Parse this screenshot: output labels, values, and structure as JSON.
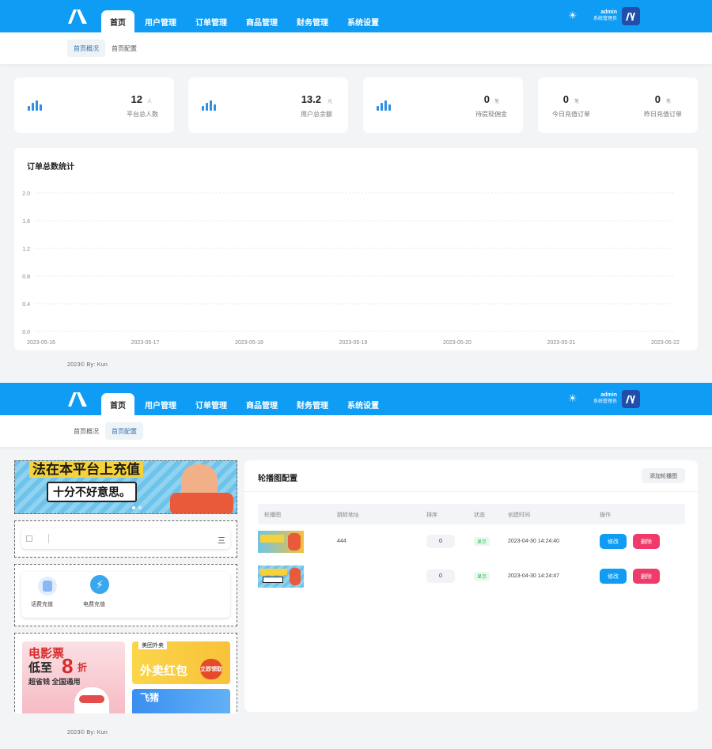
{
  "header": {
    "nav": [
      "首页",
      "用户管理",
      "订单管理",
      "商品管理",
      "财务管理",
      "系统设置"
    ],
    "user_name": "admin",
    "user_role": "系统管理员",
    "avatar_text": "ꟿ"
  },
  "subtabs": [
    "首页概况",
    "首页配置"
  ],
  "stats": [
    {
      "value": "12",
      "unit": "人",
      "label": "平台总人数"
    },
    {
      "value": "13.2",
      "unit": "元",
      "label": "用户总余额"
    },
    {
      "value": "0",
      "unit": "笔",
      "label": "待提现佣金"
    },
    {
      "value": "0",
      "unit": "笔",
      "label": "今日充值订单"
    },
    {
      "value": "0",
      "unit": "笔",
      "label": "昨日充值订单"
    }
  ],
  "chart_title": "订单总数统计",
  "chart_data": {
    "type": "line",
    "title": "订单总数统计",
    "x": [
      "2023-05-16",
      "2023-05-17",
      "2023-05-18",
      "2023-05-19",
      "2023-05-20",
      "2023-05-21",
      "2023-05-22"
    ],
    "yticks": [
      "0.0",
      "0.4",
      "0.8",
      "1.2",
      "1.6",
      "2.0"
    ],
    "ylim": [
      0,
      2.0
    ],
    "series": [
      {
        "values": [
          0,
          0,
          0,
          0,
          0,
          0,
          0
        ]
      }
    ],
    "grid": true
  },
  "footer": "2023© By: Kun",
  "banner_panel": {
    "title": "轮播图配置",
    "add_button": "添加轮播图",
    "columns": [
      "轮播图",
      "跳转地址",
      "排序",
      "状态",
      "创建时间",
      "操作"
    ],
    "rows": [
      {
        "url": "444",
        "sort": "0",
        "status": "显示",
        "created": "2023-04-30 14:24:40",
        "edit": "修改",
        "delete": "删除"
      },
      {
        "url": "",
        "sort": "0",
        "status": "显示",
        "created": "2023-04-30 14:24:47",
        "edit": "修改",
        "delete": "删除"
      }
    ]
  },
  "preview": {
    "banner_text_1": "法在本平台上充值",
    "banner_text_2": "十分不好意思。",
    "search_right": "三",
    "service_1": "话费充值",
    "service_2": "电费充值",
    "promo_movie_1": "电影票",
    "promo_movie_2": "低至",
    "promo_movie_num": "8",
    "promo_movie_zhe": "折",
    "promo_movie_3": "超省钱 全国通用",
    "promo_waimai_brand": "美团外卖",
    "promo_waimai": "外卖红包",
    "promo_waimai_btn": "立即领取",
    "promo_blue": "飞猪"
  },
  "colors": {
    "primary": "#0e9cf5",
    "danger": "#ee3b6c",
    "success": "#2eb35a"
  }
}
